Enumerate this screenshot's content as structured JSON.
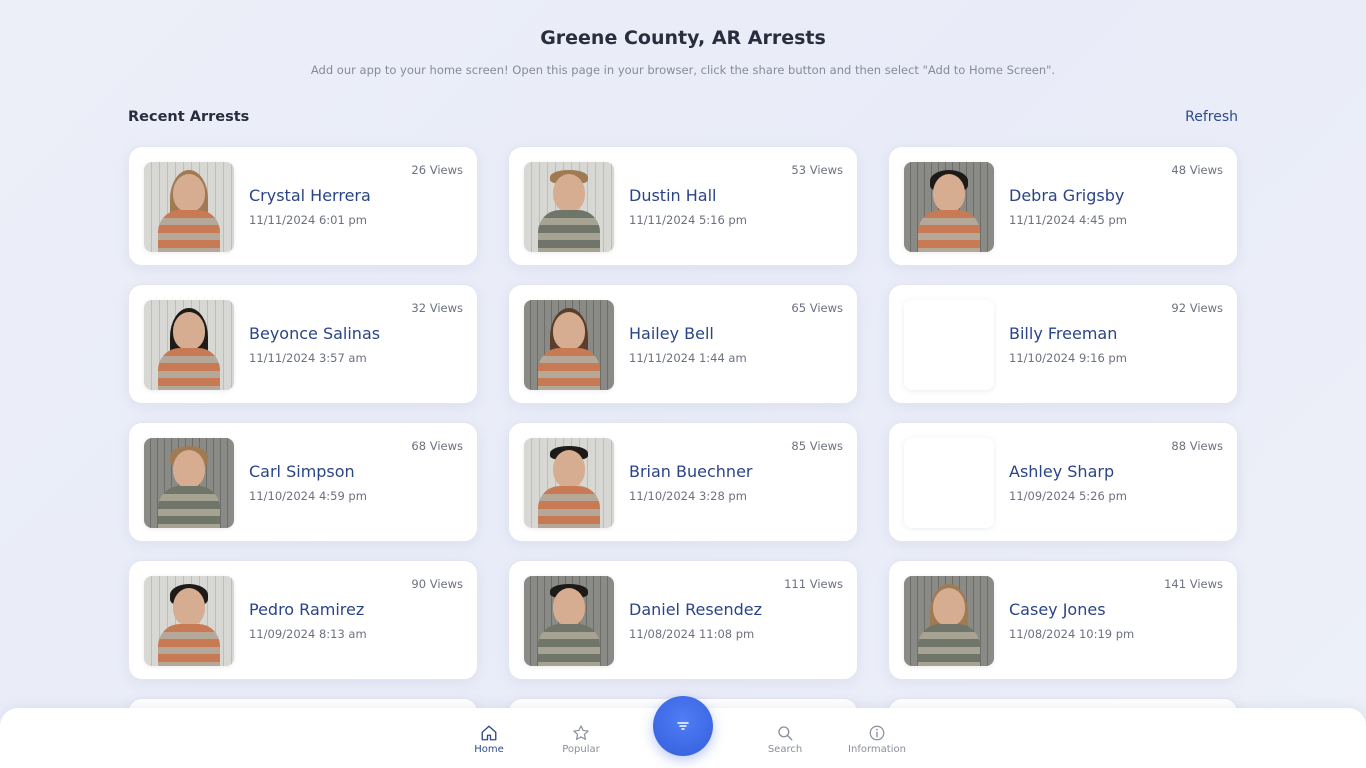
{
  "header": {
    "title": "Greene County, AR Arrests",
    "subtitle": "Add our app to your home screen! Open this page in your browser, click the share button and then select \"Add to Home Screen\"."
  },
  "section": {
    "title": "Recent Arrests",
    "refresh_label": "Refresh"
  },
  "arrests": [
    {
      "name": "Crystal Herrera",
      "date": "11/11/2024 6:01 pm",
      "views": "26 Views",
      "photo": "mugshot"
    },
    {
      "name": "Dustin Hall",
      "date": "11/11/2024 5:16 pm",
      "views": "53 Views",
      "photo": "mugshot"
    },
    {
      "name": "Debra Grigsby",
      "date": "11/11/2024 4:45 pm",
      "views": "48 Views",
      "photo": "mugshot"
    },
    {
      "name": "Beyonce Salinas",
      "date": "11/11/2024 3:57 am",
      "views": "32 Views",
      "photo": "mugshot"
    },
    {
      "name": "Hailey Bell",
      "date": "11/11/2024 1:44 am",
      "views": "65 Views",
      "photo": "mugshot"
    },
    {
      "name": "Billy Freeman",
      "date": "11/10/2024 9:16 pm",
      "views": "92 Views",
      "photo": "none"
    },
    {
      "name": "Carl Simpson",
      "date": "11/10/2024 4:59 pm",
      "views": "68 Views",
      "photo": "mugshot"
    },
    {
      "name": "Brian Buechner",
      "date": "11/10/2024 3:28 pm",
      "views": "85 Views",
      "photo": "mugshot"
    },
    {
      "name": "Ashley Sharp",
      "date": "11/09/2024 5:26 pm",
      "views": "88 Views",
      "photo": "none"
    },
    {
      "name": "Pedro Ramirez",
      "date": "11/09/2024 8:13 am",
      "views": "90 Views",
      "photo": "mugshot"
    },
    {
      "name": "Daniel Resendez",
      "date": "11/08/2024 11:08 pm",
      "views": "111 Views",
      "photo": "mugshot"
    },
    {
      "name": "Casey Jones",
      "date": "11/08/2024 10:19 pm",
      "views": "141 Views",
      "photo": "mugshot"
    }
  ],
  "nav": {
    "home": {
      "label": "Home",
      "icon": "home-icon",
      "active": true
    },
    "popular": {
      "label": "Popular",
      "icon": "star-icon"
    },
    "filter": {
      "icon": "filter-icon"
    },
    "search": {
      "label": "Search",
      "icon": "search-icon"
    },
    "information": {
      "label": "Information",
      "icon": "info-icon"
    }
  },
  "colors": {
    "accent": "#2c4a8c",
    "fab": "#3c67e4",
    "background": "#eceff8"
  }
}
